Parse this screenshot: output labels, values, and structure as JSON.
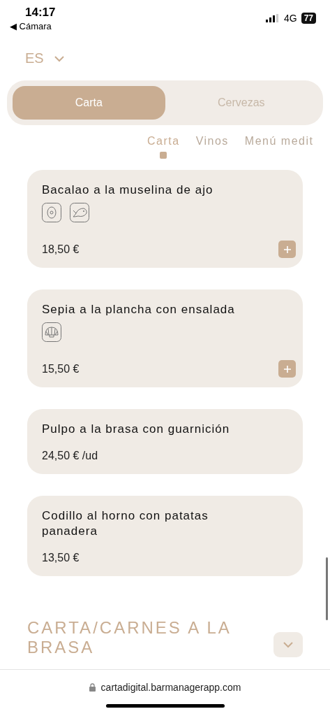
{
  "status_bar": {
    "time": "14:17",
    "back_label": "◀ Cámara",
    "network": "4G",
    "battery": "77"
  },
  "language": {
    "label": "ES"
  },
  "tabs": [
    {
      "label": "Carta",
      "selected": true
    },
    {
      "label": "Cervezas",
      "selected": false
    }
  ],
  "subtabs": [
    {
      "label": "Carta",
      "selected": true
    },
    {
      "label": "Vinos",
      "selected": false
    },
    {
      "label": "Menú medit",
      "selected": false
    }
  ],
  "dishes": [
    {
      "name": "Bacalao a la muselina de ajo",
      "allergens": [
        {
          "kind": "egg"
        },
        {
          "kind": "fish"
        }
      ],
      "price": "18,50 €",
      "addable": true
    },
    {
      "name": "Sepia a la plancha con ensalada",
      "allergens": [
        {
          "kind": "mollusc"
        }
      ],
      "price": "15,50 €",
      "addable": true
    },
    {
      "name": "Pulpo a la brasa con guarnición",
      "price": "24,50 € /ud",
      "addable": false
    },
    {
      "name": "Codillo al horno con patatas panadera",
      "price": "13,50 €",
      "addable": false
    }
  ],
  "next_section": {
    "title": "CARTA/CARNES A LA BRASA",
    "expanded": false
  },
  "browser": {
    "url": "cartadigital.barmanagerapp.com"
  }
}
